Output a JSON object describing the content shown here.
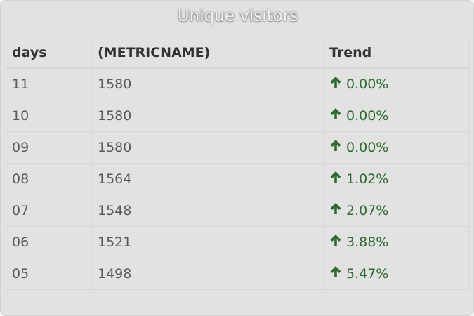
{
  "title": "Unique visitors",
  "table": {
    "headers": [
      "days",
      "(METRICNAME)",
      "Trend"
    ],
    "rows": [
      {
        "day": "11",
        "value": "1580",
        "trend": "0.00%",
        "direction": "up"
      },
      {
        "day": "10",
        "value": "1580",
        "trend": "0.00%",
        "direction": "up"
      },
      {
        "day": "09",
        "value": "1580",
        "trend": "0.00%",
        "direction": "up"
      },
      {
        "day": "08",
        "value": "1564",
        "trend": "1.02%",
        "direction": "up"
      },
      {
        "day": "07",
        "value": "1548",
        "trend": "2.07%",
        "direction": "up"
      },
      {
        "day": "06",
        "value": "1521",
        "trend": "3.88%",
        "direction": "up"
      },
      {
        "day": "05",
        "value": "1498",
        "trend": "5.47%",
        "direction": "up"
      }
    ]
  },
  "colors": {
    "panel_background": "#e2e2e2",
    "trend_up": "#2e6b2e",
    "header_text": "#333333",
    "cell_text": "#5a5a5a"
  },
  "icons": {
    "trend_up": "arrow-up-icon"
  }
}
